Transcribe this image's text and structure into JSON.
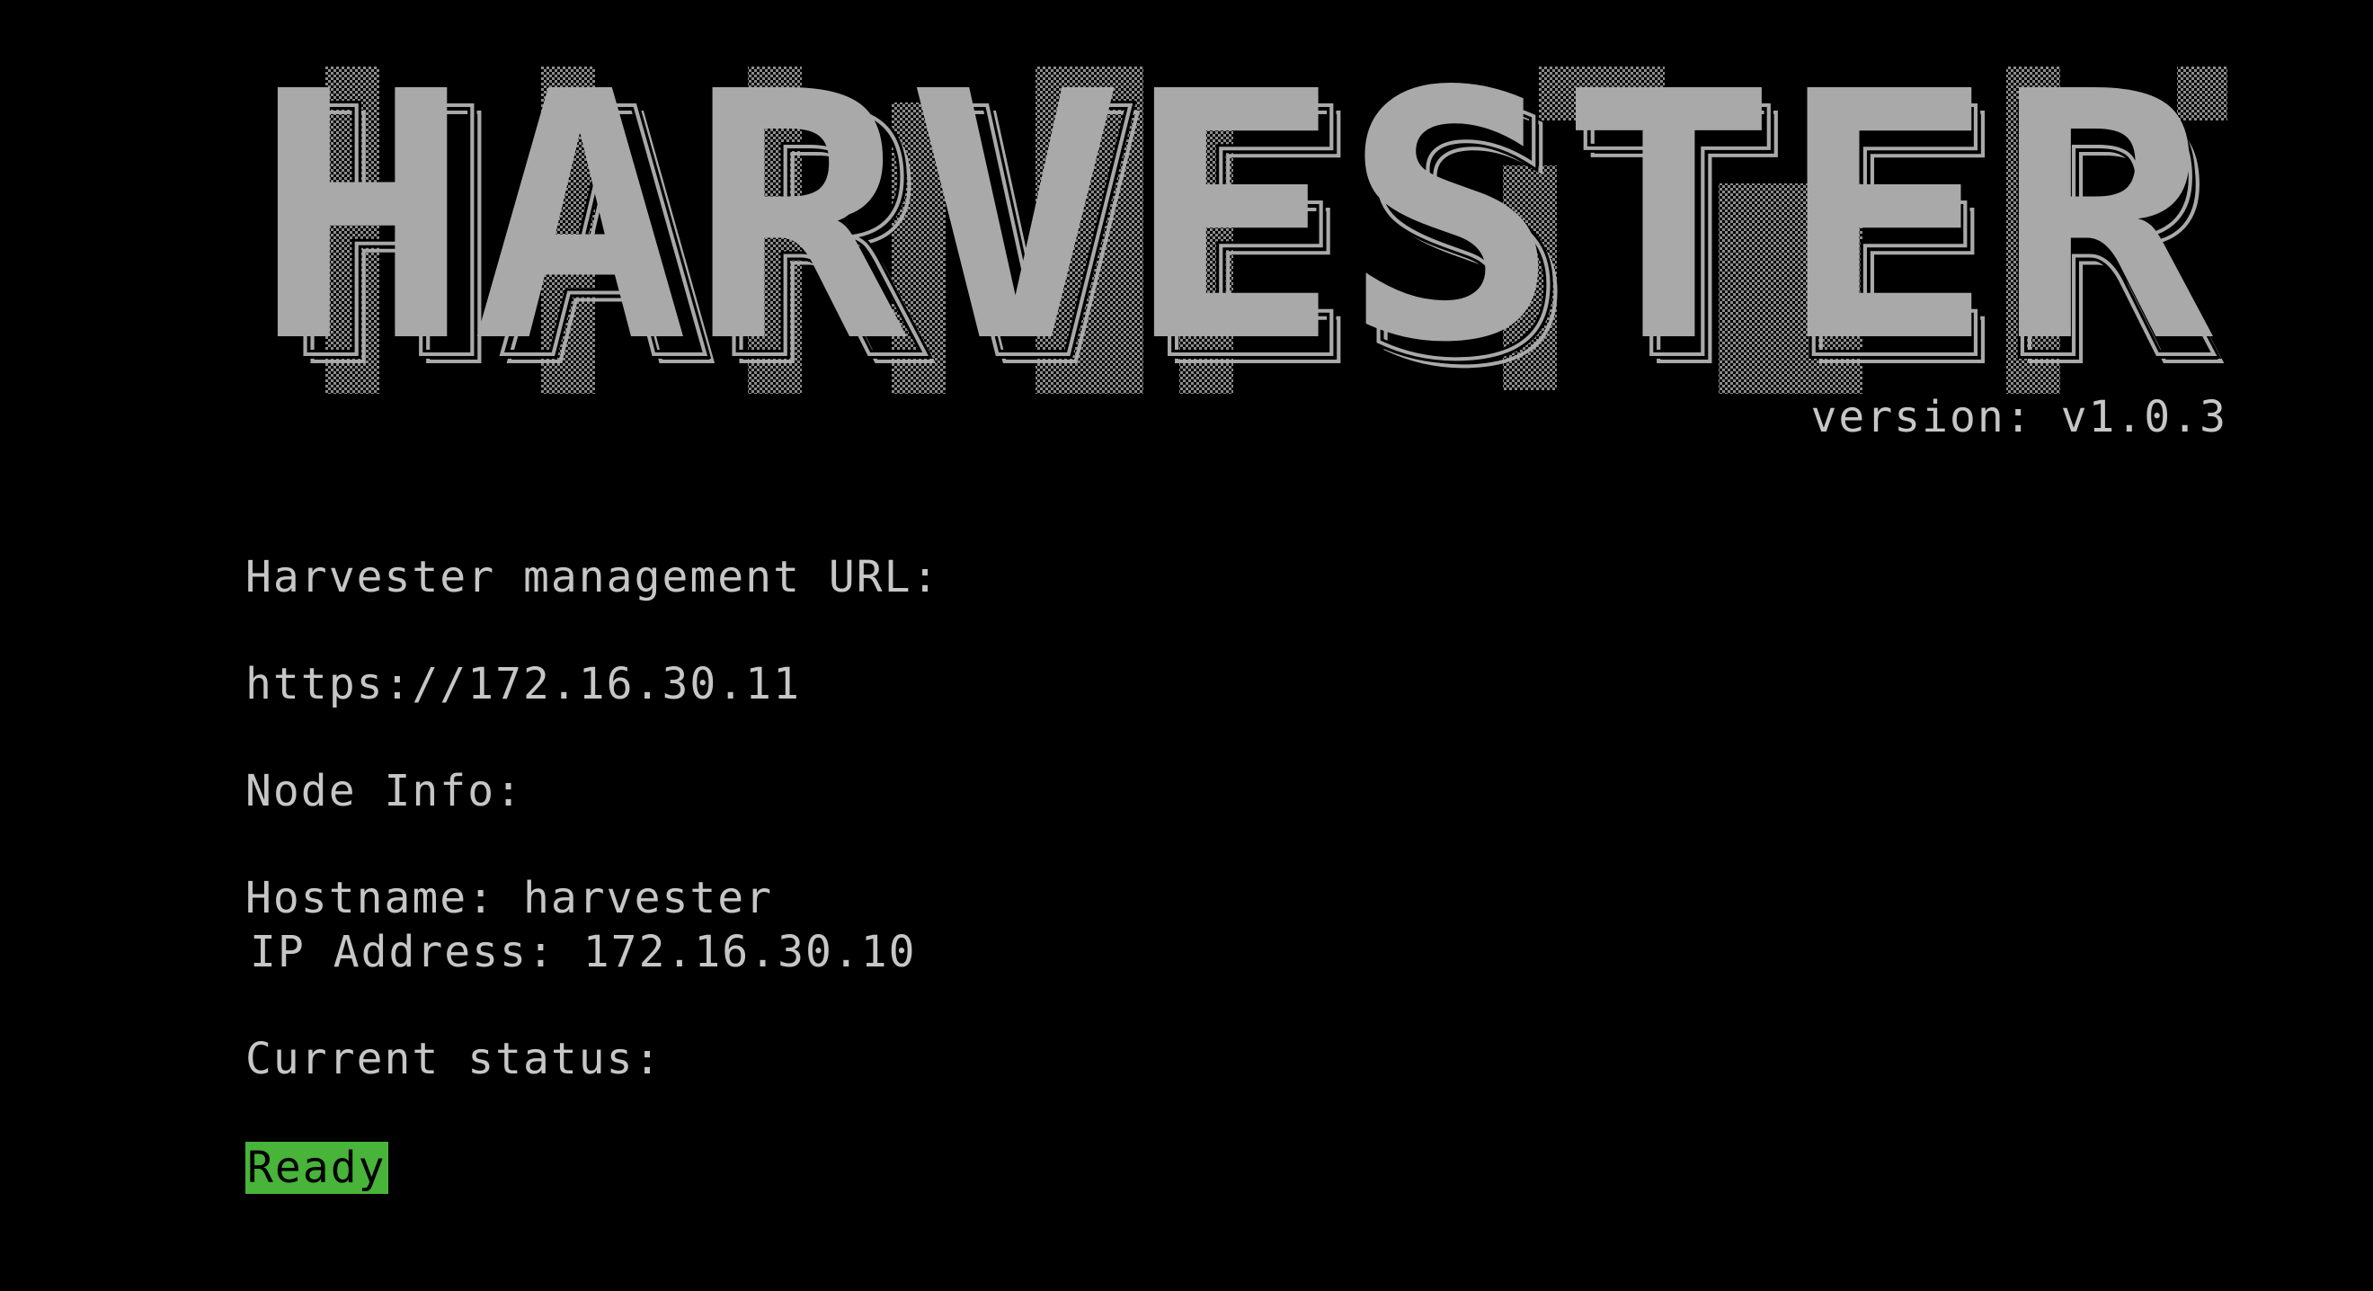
{
  "colors": {
    "background": "#000000",
    "text": "#c6c6c6",
    "banner_fill": "#a9a9a9",
    "status_ready": "#48b43a"
  },
  "banner": {
    "title": "HARVESTER"
  },
  "version": "version: v1.0.3",
  "management": {
    "label": "Harvester management URL:",
    "url": "https://172.16.30.11"
  },
  "node_info": {
    "label": "Node Info:",
    "hostname": "Hostname: harvester",
    "ip_address": "IP Address: 172.16.30.10"
  },
  "status": {
    "label": "Current status:",
    "value": "Ready"
  }
}
